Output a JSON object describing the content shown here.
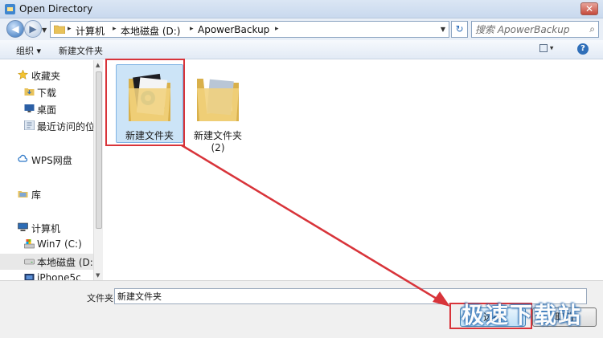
{
  "window": {
    "title": "Open Directory",
    "close_glyph": "✕"
  },
  "address_bar": {
    "crumbs": [
      "计算机",
      "本地磁盘 (D:)",
      "ApowerBackup"
    ],
    "separator": "▸",
    "refresh_glyph": "↻"
  },
  "search": {
    "placeholder": "搜索 ApowerBackup",
    "icon": "search-icon"
  },
  "toolbar": {
    "organize_label": "组织 ▾",
    "new_folder_label": "新建文件夹",
    "help_glyph": "?"
  },
  "nav_pane": {
    "items": [
      {
        "label": "收藏夹",
        "icon": "star-icon"
      },
      {
        "label": "下载",
        "icon": "downloads-folder-icon"
      },
      {
        "label": "桌面",
        "icon": "desktop-icon"
      },
      {
        "label": "最近访问的位",
        "icon": "recent-places-icon"
      },
      {
        "label": "WPS网盘",
        "icon": "cloud-icon"
      },
      {
        "label": "库",
        "icon": "library-icon"
      },
      {
        "label": "计算机",
        "icon": "computer-icon"
      },
      {
        "label": "Win7 (C:)",
        "icon": "system-drive-icon"
      },
      {
        "label": "本地磁盘 (D:",
        "icon": "drive-icon",
        "selected": true
      },
      {
        "label": "iPhone5c",
        "icon": "phone-icon"
      }
    ]
  },
  "files": [
    {
      "name": "新建文件夹",
      "selected": true
    },
    {
      "name": "新建文件夹\n(2)",
      "selected": false
    }
  ],
  "footer": {
    "filename_label": "文件夹:",
    "filename_value": "新建文件夹",
    "ok_label": "选择",
    "cancel_label": "取消"
  },
  "watermark": {
    "text": "极速下载站"
  },
  "colors": {
    "annotation_red": "#d8343a",
    "selection_blue": "#cce4f7",
    "accent_blue": "#2f6fb9"
  }
}
